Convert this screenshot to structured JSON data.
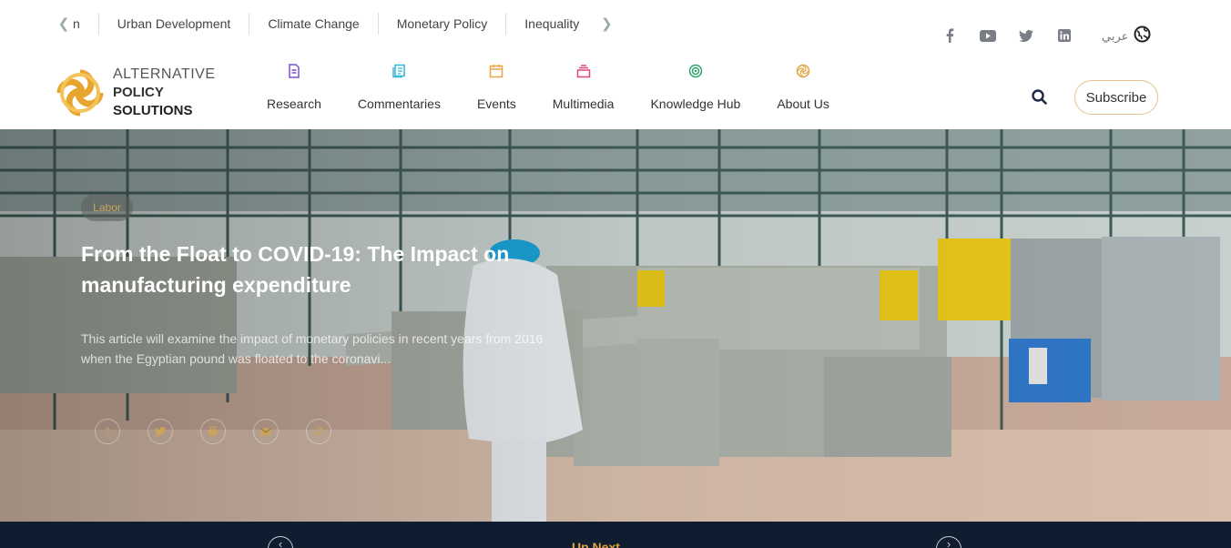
{
  "topics": {
    "cut_label": "n",
    "items": [
      "Urban Development",
      "Climate Change",
      "Monetary Policy",
      "Inequality"
    ]
  },
  "social": [
    "facebook",
    "youtube",
    "twitter",
    "linkedin"
  ],
  "language": "عربي",
  "logo": {
    "line1": "ALTERNATIVE",
    "line2": "POLICY",
    "line3": "SOLUTIONS"
  },
  "nav": [
    {
      "label": "Research",
      "icon": "document-icon",
      "color": "#7b4fd6"
    },
    {
      "label": "Commentaries",
      "icon": "notes-icon",
      "color": "#36b7d4"
    },
    {
      "label": "Events",
      "icon": "calendar-icon",
      "color": "#f0a44a"
    },
    {
      "label": "Multimedia",
      "icon": "media-icon",
      "color": "#e0467a"
    },
    {
      "label": "Knowledge Hub",
      "icon": "target-icon",
      "color": "#2aa36a"
    },
    {
      "label": "About Us",
      "icon": "logo-icon",
      "color": "#e0a33b"
    }
  ],
  "subscribe": "Subscribe",
  "hero": {
    "tag": "Labor",
    "title": "From the Float to COVID-19: The Impact on manufacturing expenditure",
    "description": "This article will examine the impact of monetary policies in recent years from 2016 when the Egyptian pound was floated to the coronavi..."
  },
  "up_next": "Up Next"
}
